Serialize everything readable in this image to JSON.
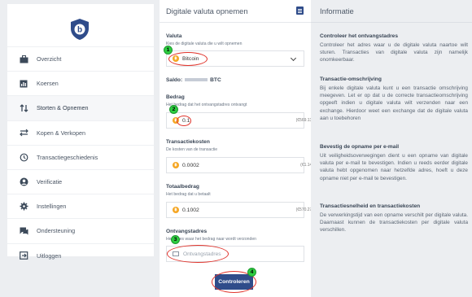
{
  "sidebar": {
    "items": [
      {
        "label": "Overzicht",
        "icon": "briefcase-icon"
      },
      {
        "label": "Koersen",
        "icon": "chart-icon"
      },
      {
        "label": "Storten & Opnemen",
        "icon": "transfer-icon",
        "active": true
      },
      {
        "label": "Kopen & Verkopen",
        "icon": "exchange-icon"
      },
      {
        "label": "Transactiegeschiedenis",
        "icon": "history-icon"
      },
      {
        "label": "Verificatie",
        "icon": "user-icon"
      },
      {
        "label": "Instellingen",
        "icon": "gear-icon"
      },
      {
        "label": "Ondersteuning",
        "icon": "chat-icon"
      },
      {
        "label": "Uitloggen",
        "icon": "logout-icon"
      }
    ]
  },
  "main": {
    "title": "Digitale valuta opnemen",
    "valuta": {
      "label": "Valuta",
      "help": "Kies de digitale valuta die u wilt opnemen",
      "value": "Bitcoin"
    },
    "saldo": {
      "label": "Saldo:",
      "unit": "BTC"
    },
    "bedrag": {
      "label": "Bedrag",
      "help": "Het bedrag dat het ontvangstadres ontvangt",
      "value": "0.1",
      "suffix": "(€569.13)"
    },
    "transactiekosten": {
      "label": "Transactiekosten",
      "help": "De kosten van de transactie",
      "value": "0.0002",
      "suffix": "(€1.14)"
    },
    "totaalbedrag": {
      "label": "Totaalbedrag",
      "help": "Het bedrag dat u betaalt",
      "value": "0.1002",
      "suffix": "(€570.27)"
    },
    "ontvangstadres": {
      "label": "Ontvangstadres",
      "help": "Het adres waar het bedrag naar wordt verzonden",
      "placeholder": "Ontvangstadres"
    },
    "submit_label": "Controleren"
  },
  "annotations": [
    "1",
    "2",
    "3",
    "4"
  ],
  "info": {
    "title": "Informatie",
    "sections": [
      {
        "heading": "Controleer het ontvangstadres",
        "body": "Controleer het adres waar u de digitale valuta naartoe wilt sturen. Transacties van digitale valuta zijn namelijk onomkeerbaar."
      },
      {
        "heading": "Transactie-omschrijving",
        "body": "Bij enkele digitale valuta kunt u een transactie omschrijving meegeven. Let er op dat u de correcte transactieomschrijving opgeeft indien u digitale valuta wilt verzenden naar een exchange. Hierdoor weet een exchange dat de digitale valuta aan u toebehoren"
      },
      {
        "heading": "Bevestig de opname per e-mail",
        "body": "Uit veiligheidsoverwegingen dient u een opname van digitale valuta per e-mail te bevestigen. Indien u reeds eerder digitale valuta hebt opgenomen naar hetzelfde adres, hoeft u deze opname niet per e-mail te bevestigen."
      },
      {
        "heading": "Transactiesnelheid en transactiekosten",
        "body": "De verwerkingstijd van een opname verschilt per digitale valuta. Daarnaast kunnen de transactiekosten per digitale valuta verschillen."
      }
    ]
  },
  "colors": {
    "primary": "#2f4c8a",
    "bitcoin": "#f5a623",
    "annotation_ring": "#e0342c",
    "annotation_badge": "#2ecc40"
  }
}
